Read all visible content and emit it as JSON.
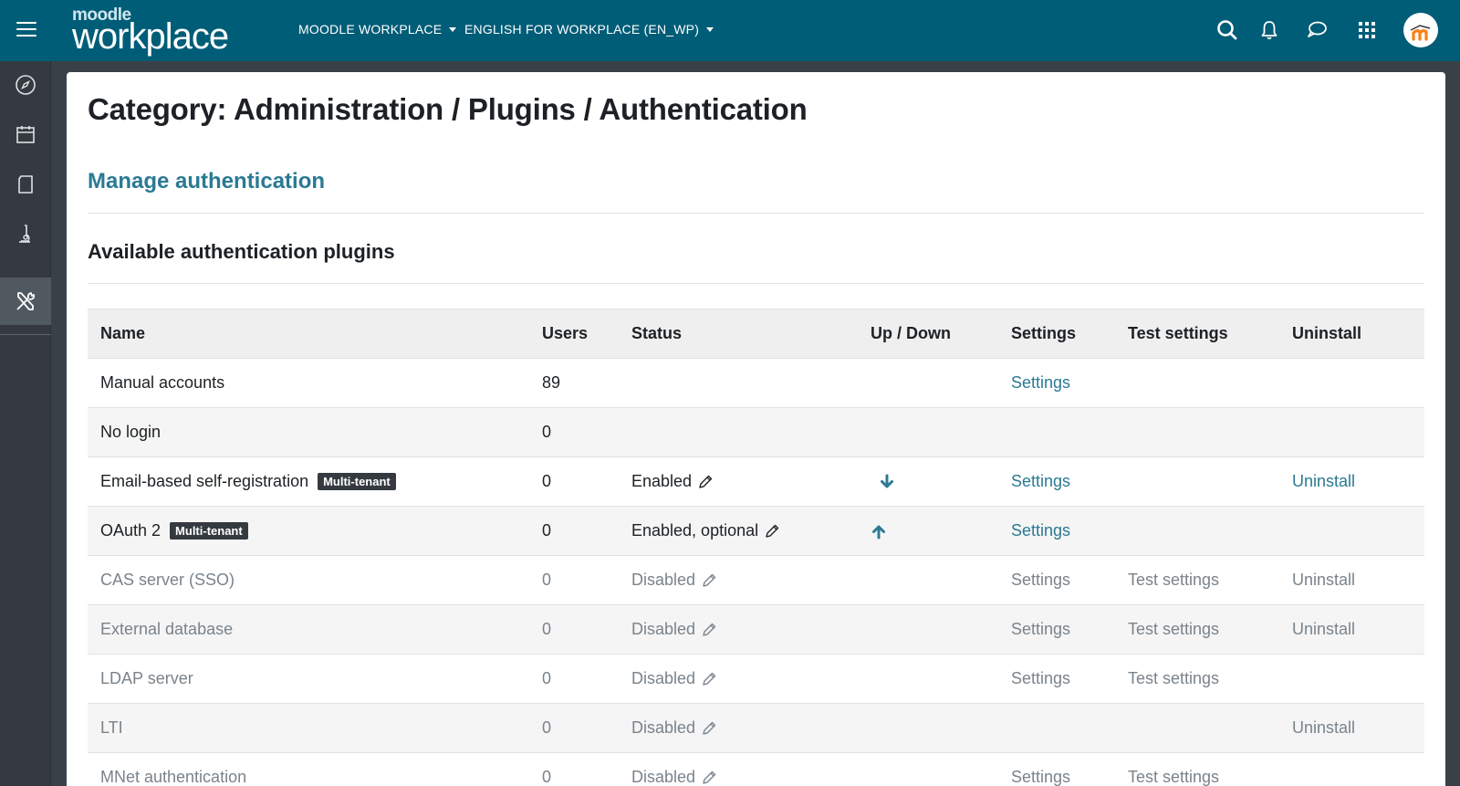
{
  "navbar": {
    "logo_small": "moodle",
    "logo_main": "workplace",
    "menu1": "MOODLE WORKPLACE",
    "menu2": "ENGLISH FOR WORKPLACE (EN_WP)",
    "icons": [
      "search-icon",
      "bell-icon",
      "chat-icon",
      "apps-grid-icon"
    ],
    "avatar_icon": "moodle-m-avatar",
    "colors": {
      "bg": "#005d77",
      "accent": "#f98012"
    }
  },
  "rail": {
    "items": [
      "compass-icon",
      "calendar-icon",
      "book-icon",
      "flask-icon",
      "tools-icon"
    ],
    "active": "tools-icon"
  },
  "page": {
    "title": "Category: Administration / Plugins / Authentication",
    "section": "Manage authentication",
    "subheading": "Available authentication plugins"
  },
  "table": {
    "headers": {
      "name": "Name",
      "users": "Users",
      "status": "Status",
      "updown": "Up / Down",
      "settings": "Settings",
      "test": "Test settings",
      "uninstall": "Uninstall"
    },
    "rows": [
      {
        "name": "Manual accounts",
        "badge": "",
        "users": "89",
        "status": "",
        "updown": "",
        "settings": "Settings",
        "test": "",
        "uninstall": ""
      },
      {
        "name": "No login",
        "badge": "",
        "users": "0",
        "status": "",
        "updown": "",
        "settings": "",
        "test": "",
        "uninstall": ""
      },
      {
        "name": "Email-based self-registration",
        "badge": "Multi-tenant",
        "users": "0",
        "status": "Enabled",
        "updown": "down",
        "settings": "Settings",
        "test": "",
        "uninstall": "Uninstall"
      },
      {
        "name": "OAuth 2",
        "badge": "Multi-tenant",
        "users": "0",
        "status": "Enabled, optional",
        "updown": "up",
        "settings": "Settings",
        "test": "",
        "uninstall": ""
      },
      {
        "name": "CAS server (SSO)",
        "badge": "",
        "users": "0",
        "status": "Disabled",
        "updown": "",
        "settings": "Settings",
        "test": "Test settings",
        "uninstall": "Uninstall"
      },
      {
        "name": "External database",
        "badge": "",
        "users": "0",
        "status": "Disabled",
        "updown": "",
        "settings": "Settings",
        "test": "Test settings",
        "uninstall": "Uninstall"
      },
      {
        "name": "LDAP server",
        "badge": "",
        "users": "0",
        "status": "Disabled",
        "updown": "",
        "settings": "Settings",
        "test": "Test settings",
        "uninstall": ""
      },
      {
        "name": "LTI",
        "badge": "",
        "users": "0",
        "status": "Disabled",
        "updown": "",
        "settings": "",
        "test": "",
        "uninstall": "Uninstall"
      },
      {
        "name": "MNet authentication",
        "badge": "",
        "users": "0",
        "status": "Disabled",
        "updown": "",
        "settings": "Settings",
        "test": "Test settings",
        "uninstall": ""
      }
    ]
  }
}
